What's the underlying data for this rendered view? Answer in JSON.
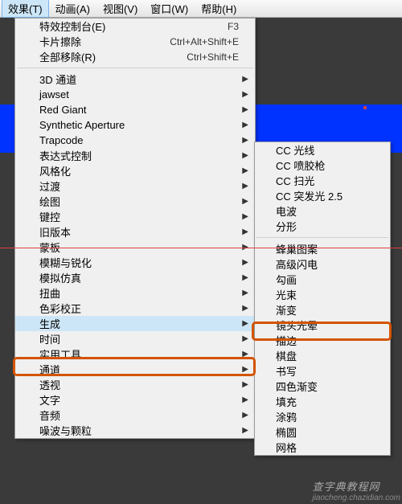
{
  "menubar": {
    "items": [
      {
        "label": "效果(T)",
        "active": true
      },
      {
        "label": "动画(A)"
      },
      {
        "label": "视图(V)"
      },
      {
        "label": "窗口(W)"
      },
      {
        "label": "帮助(H)"
      }
    ]
  },
  "main_menu": {
    "group1": [
      {
        "label": "特效控制台(E)",
        "short": "F3"
      },
      {
        "label": "卡片擦除",
        "short": "Ctrl+Alt+Shift+E"
      },
      {
        "label": "全部移除(R)",
        "short": "Ctrl+Shift+E"
      }
    ],
    "group2": [
      {
        "label": "3D 通道",
        "sub": true
      },
      {
        "label": "jawset",
        "sub": true
      },
      {
        "label": "Red Giant",
        "sub": true
      },
      {
        "label": "Synthetic Aperture",
        "sub": true
      },
      {
        "label": "Trapcode",
        "sub": true
      },
      {
        "label": "表达式控制",
        "sub": true
      },
      {
        "label": "风格化",
        "sub": true
      },
      {
        "label": "过渡",
        "sub": true
      },
      {
        "label": "绘图",
        "sub": true
      },
      {
        "label": "键控",
        "sub": true
      },
      {
        "label": "旧版本",
        "sub": true
      },
      {
        "label": "蒙板",
        "sub": true
      },
      {
        "label": "模糊与锐化",
        "sub": true
      },
      {
        "label": "模拟仿真",
        "sub": true
      },
      {
        "label": "扭曲",
        "sub": true
      },
      {
        "label": "色彩校正",
        "sub": true
      },
      {
        "label": "生成",
        "sub": true,
        "hover": true
      },
      {
        "label": "时间",
        "sub": true
      },
      {
        "label": "实用工具",
        "sub": true
      },
      {
        "label": "通道",
        "sub": true
      },
      {
        "label": "透视",
        "sub": true
      },
      {
        "label": "文字",
        "sub": true
      },
      {
        "label": "音频",
        "sub": true
      },
      {
        "label": "噪波与颗粒",
        "sub": true
      }
    ]
  },
  "sub_menu": {
    "group1": [
      "CC 光线",
      "CC 喷胶枪",
      "CC 扫光",
      "CC 突发光 2.5",
      "电波",
      "分形"
    ],
    "group2": [
      "蜂巢图案",
      "高级闪电",
      "勾画",
      "光束",
      "渐变",
      "镜头光晕",
      "描边",
      "棋盘",
      "书写",
      "四色渐变",
      "填充",
      "涂鸦",
      "椭圆",
      "网格"
    ]
  },
  "watermark": {
    "main": "查字典教程网",
    "sub": "jiaocheng.chazidian.com"
  }
}
